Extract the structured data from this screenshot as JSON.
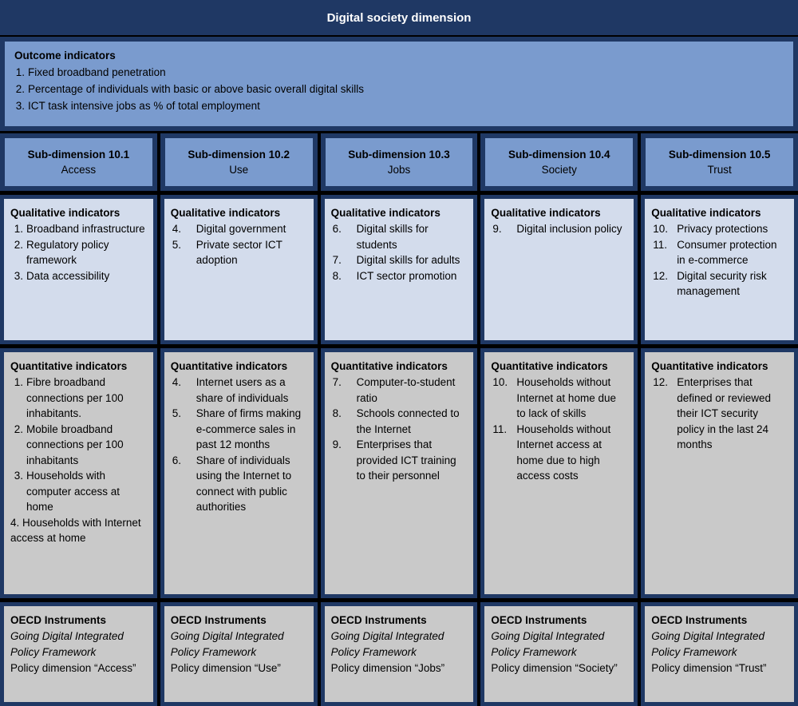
{
  "title": "Digital society dimension",
  "outcome": {
    "heading": "Outcome indicators",
    "items": [
      {
        "num": "1.",
        "text": "Fixed broadband penetration"
      },
      {
        "num": "2.",
        "text": "Percentage of individuals with basic or above basic overall digital skills"
      },
      {
        "num": "3.",
        "text": "ICT task intensive jobs as % of total employment"
      }
    ]
  },
  "labels": {
    "qualitative": "Qualitative indicators",
    "quantitative": "Quantitative indicators",
    "oecd": "OECD Instruments"
  },
  "colors": {
    "title_bar": "#1f3864",
    "frame": "#1f3864",
    "outcome_fill": "#7a9bce",
    "subdim_fill": "#7a9bce",
    "qualitative_fill": "#d3dcec",
    "quantitative_fill": "#c9c9c9",
    "oecd_fill": "#c9c9c9",
    "gap": "#000000"
  },
  "columns": [
    {
      "subdimension": {
        "title": "Sub-dimension 10.1",
        "subtitle": "Access"
      },
      "qualitative": [
        {
          "num": "1.",
          "text": "Broadband infrastructure"
        },
        {
          "num": "2.",
          "text": "Regulatory policy framework"
        },
        {
          "num": "3.",
          "text": "Data accessibility"
        }
      ],
      "quantitative": [
        {
          "num": "1.",
          "text": "Fibre broadband connections per 100 inhabitants."
        },
        {
          "num": "2.",
          "text": "Mobile broadband connections per 100 inhabitants"
        },
        {
          "num": "3.",
          "text": "Households with computer access at home"
        },
        {
          "num": "4.",
          "text": "Households with Internet access at home"
        }
      ],
      "oecd": {
        "framework": "Going Digital Integrated Policy Framework",
        "dimension": "Policy dimension “Access”"
      }
    },
    {
      "subdimension": {
        "title": "Sub-dimension 10.2",
        "subtitle": "Use"
      },
      "qualitative": [
        {
          "num": "4.",
          "text": "Digital government"
        },
        {
          "num": "5.",
          "text": "Private sector ICT adoption"
        }
      ],
      "quantitative": [
        {
          "num": "4.",
          "text": "Internet users as a share of individuals"
        },
        {
          "num": "5.",
          "text": "Share of firms making e-commerce sales in past 12 months"
        },
        {
          "num": "6.",
          "text": "Share of individuals using the Internet to connect with public authorities"
        }
      ],
      "oecd": {
        "framework": "Going Digital Integrated Policy Framework",
        "dimension": "Policy dimension “Use”"
      }
    },
    {
      "subdimension": {
        "title": "Sub-dimension 10.3",
        "subtitle": "Jobs"
      },
      "qualitative": [
        {
          "num": "6.",
          "text": "Digital skills for students"
        },
        {
          "num": "7.",
          "text": "Digital skills for adults"
        },
        {
          "num": "8.",
          "text": "ICT sector promotion"
        }
      ],
      "quantitative": [
        {
          "num": "7.",
          "text": "Computer-to-student ratio"
        },
        {
          "num": "8.",
          "text": "Schools connected to the Internet"
        },
        {
          "num": "9.",
          "text": "Enterprises that provided ICT training to their personnel"
        }
      ],
      "oecd": {
        "framework": "Going Digital Integrated Policy Framework",
        "dimension": "Policy dimension “Jobs”"
      }
    },
    {
      "subdimension": {
        "title": "Sub-dimension 10.4",
        "subtitle": "Society"
      },
      "qualitative": [
        {
          "num": "9.",
          "text": "Digital inclusion policy"
        }
      ],
      "quantitative": [
        {
          "num": "10.",
          "text": "Households without Internet at home due to lack of skills"
        },
        {
          "num": "11.",
          "text": "Households without Internet access at home due to high access costs"
        }
      ],
      "oecd": {
        "framework": "Going Digital Integrated Policy Framework",
        "dimension": "Policy dimension “Society”"
      }
    },
    {
      "subdimension": {
        "title": "Sub-dimension 10.5",
        "subtitle": "Trust"
      },
      "qualitative": [
        {
          "num": "10.",
          "text": "Privacy protections"
        },
        {
          "num": "11.",
          "text": "Consumer protection in e-commerce"
        },
        {
          "num": "12.",
          "text": "Digital security risk management"
        }
      ],
      "quantitative": [
        {
          "num": "12.",
          "text": "Enterprises that defined or reviewed their ICT security policy in the last 24 months"
        }
      ],
      "oecd": {
        "framework": "Going Digital Integrated Policy Framework",
        "dimension": "Policy dimension “Trust”"
      }
    }
  ]
}
